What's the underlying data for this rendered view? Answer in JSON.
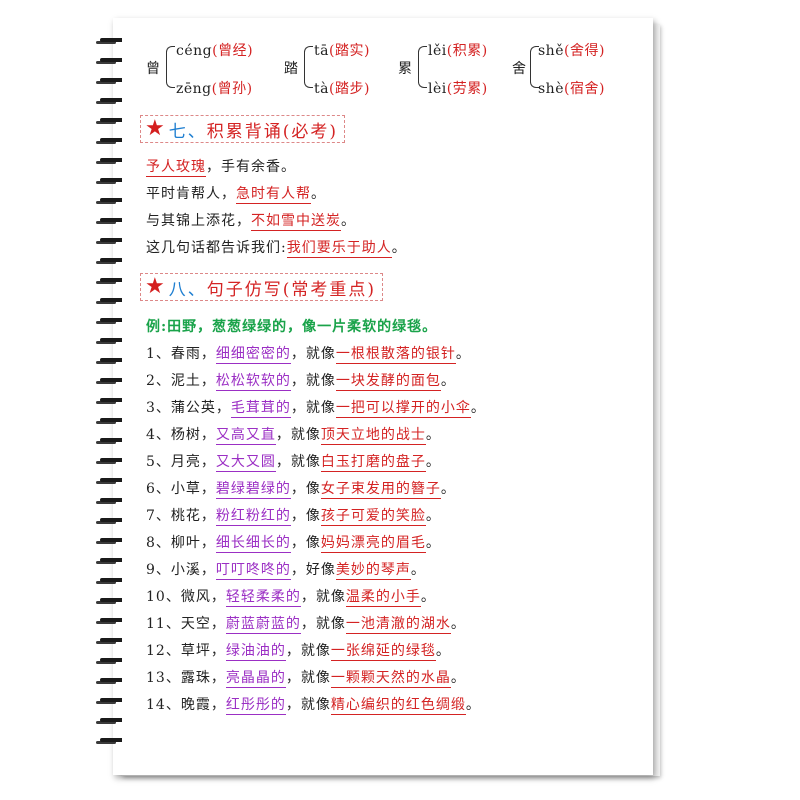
{
  "pinyin_groups": [
    {
      "char": "曾",
      "top": "céng",
      "top_word": "(曾经)",
      "bottom": "zēng",
      "bottom_word": "(曾孙)"
    },
    {
      "char": "踏",
      "top": "tā",
      "top_word": "(踏实)",
      "bottom": "tà",
      "bottom_word": "(踏步)"
    },
    {
      "char": "累",
      "top": "lěi",
      "top_word": "(积累)",
      "bottom": "lèi",
      "bottom_word": "(劳累)"
    },
    {
      "char": "舍",
      "top": "shě",
      "top_word": "(舍得)",
      "bottom": "shè",
      "bottom_word": "(宿舍)"
    }
  ],
  "section7": {
    "star": "★",
    "num": "七、",
    "title": "积累背诵(必考)",
    "lines": [
      {
        "a": "予人玫瑰",
        "b": "，手有余香。",
        "c": "",
        "d": ""
      },
      {
        "a": "平时肯帮人，",
        "b": "急时有人帮",
        "c": "。",
        "d": ""
      },
      {
        "a": "与其锦上添花，",
        "b": "不如雪中送炭",
        "c": "。",
        "d": ""
      },
      {
        "a": "这几句话都告诉我们:",
        "b": "我们要乐于助人",
        "c": "。",
        "d": ""
      }
    ]
  },
  "section8": {
    "star": "★",
    "num": "八、",
    "title": "句子仿写(常考重点)",
    "example": "例:田野，葱葱绿绿的，像一片柔软的绿毯。",
    "items": [
      {
        "n": "1、春雨，",
        "adj": "细细密密的",
        "mid": "，就像",
        "sim": "一根根散落的银针",
        "end": "。"
      },
      {
        "n": "2、泥土，",
        "adj": "松松软软的",
        "mid": "，就像",
        "sim": "一块发酵的面包",
        "end": "。"
      },
      {
        "n": "3、蒲公英，",
        "adj": "毛茸茸的",
        "mid": "，就像",
        "sim": "一把可以撑开的小伞",
        "end": "。"
      },
      {
        "n": "4、杨树，",
        "adj": "又高又直",
        "mid": "，就像",
        "sim": "顶天立地的战士",
        "end": "。"
      },
      {
        "n": "5、月亮，",
        "adj": "又大又圆",
        "mid": "，就像",
        "sim": "白玉打磨的盘子",
        "end": "。"
      },
      {
        "n": "6、小草，",
        "adj": "碧绿碧绿的",
        "mid": "，像",
        "sim": "女子束发用的簪子",
        "end": "。"
      },
      {
        "n": "7、桃花，",
        "adj": "粉红粉红的",
        "mid": "，像",
        "sim": "孩子可爱的笑脸",
        "end": "。"
      },
      {
        "n": "8、柳叶，",
        "adj": "细长细长的",
        "mid": "，像",
        "sim": "妈妈漂亮的眉毛",
        "end": "。"
      },
      {
        "n": "9、小溪，",
        "adj": "叮叮咚咚的",
        "mid": "，好像",
        "sim": "美妙的琴声",
        "end": "。"
      },
      {
        "n": "10、微风，",
        "adj": "轻轻柔柔的",
        "mid": "，就像",
        "sim": "温柔的小手",
        "end": "。"
      },
      {
        "n": "11、天空，",
        "adj": "蔚蓝蔚蓝的",
        "mid": "，就像",
        "sim": "一池清澈的湖水",
        "end": "。"
      },
      {
        "n": "12、草坪，",
        "adj": "绿油油的",
        "mid": "，就像",
        "sim": "一张绵延的绿毯",
        "end": "。"
      },
      {
        "n": "13、露珠，",
        "adj": "亮晶晶的",
        "mid": "，就像",
        "sim": "一颗颗天然的水晶",
        "end": "。"
      },
      {
        "n": "14、晚霞，",
        "adj": "红彤彤的",
        "mid": "，就像",
        "sim": "精心编织的红色绸缎",
        "end": "。"
      }
    ]
  }
}
